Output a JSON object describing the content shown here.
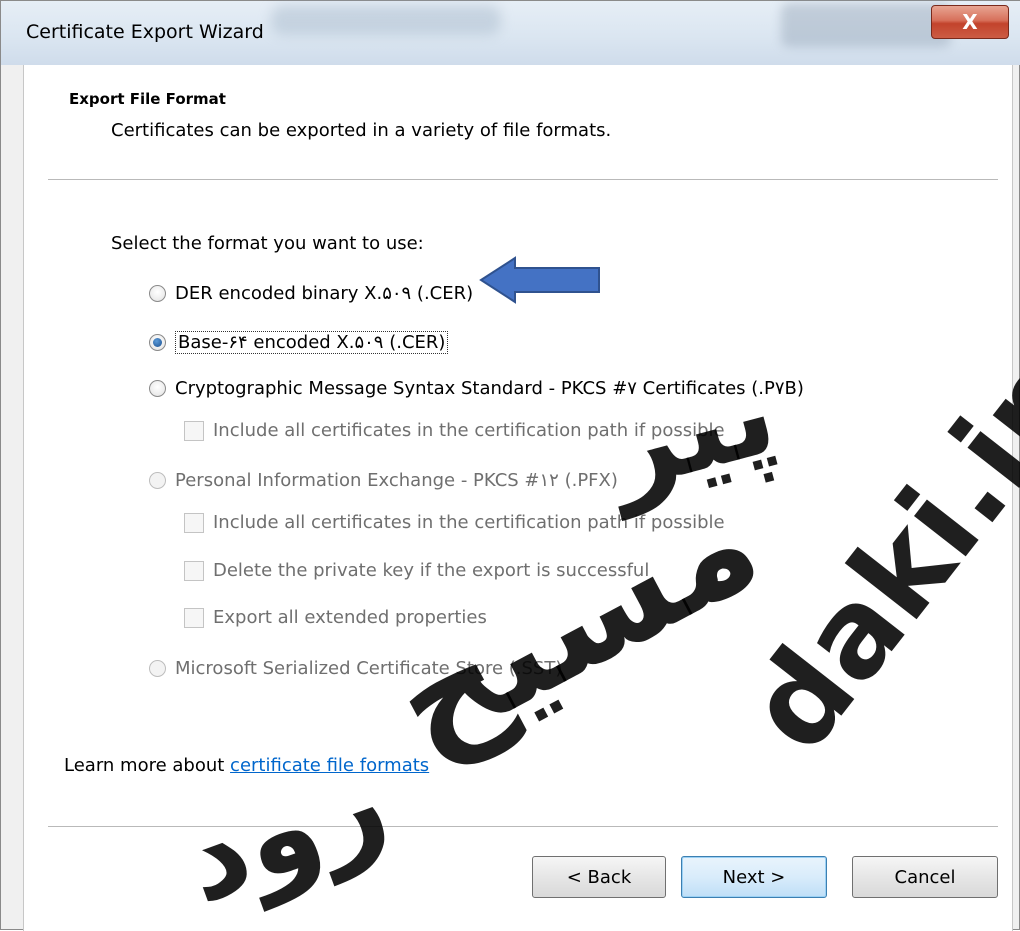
{
  "window": {
    "title": "Certificate Export Wizard",
    "close_glyph": "X"
  },
  "header": {
    "title": "Export File Format",
    "subtitle": "Certificates can be exported in a variety of file formats."
  },
  "prompt": "Select the format you want to use:",
  "options": [
    {
      "label": "DER encoded binary X.۵۰۹ (.CER)",
      "checked": false,
      "enabled": true
    },
    {
      "label": "Base-۶۴ encoded X.۵۰۹ (.CER)",
      "checked": true,
      "enabled": true
    },
    {
      "label": "Cryptographic Message Syntax Standard - PKCS #۷ Certificates (.P۷B)",
      "checked": false,
      "enabled": true
    },
    {
      "label": "Personal Information Exchange - PKCS #۱۲ (.PFX)",
      "checked": false,
      "enabled": false
    },
    {
      "label": "Microsoft Serialized Certificate Store (.SST)",
      "checked": false,
      "enabled": false
    }
  ],
  "checkboxes": [
    {
      "label": "Include all certificates in the certification path if possible",
      "enabled": false
    },
    {
      "label": "Include all certificates in the certification path if possible",
      "enabled": false
    },
    {
      "label": "Delete the private key if the export is successful",
      "enabled": false
    },
    {
      "label": "Export all extended properties",
      "enabled": false
    }
  ],
  "learn_more": {
    "prefix": "Learn more about ",
    "link": "certificate file formats"
  },
  "buttons": {
    "back": "< Back",
    "next": "Next >",
    "cancel": "Cancel"
  },
  "watermark": {
    "persian_1": "پیر",
    "persian_2": "مسیح",
    "persian_3": "رود",
    "latin": "daki.ir"
  },
  "colors": {
    "arrow": "#4472c4",
    "link": "#0066cc",
    "close_button": "#c2432c"
  }
}
